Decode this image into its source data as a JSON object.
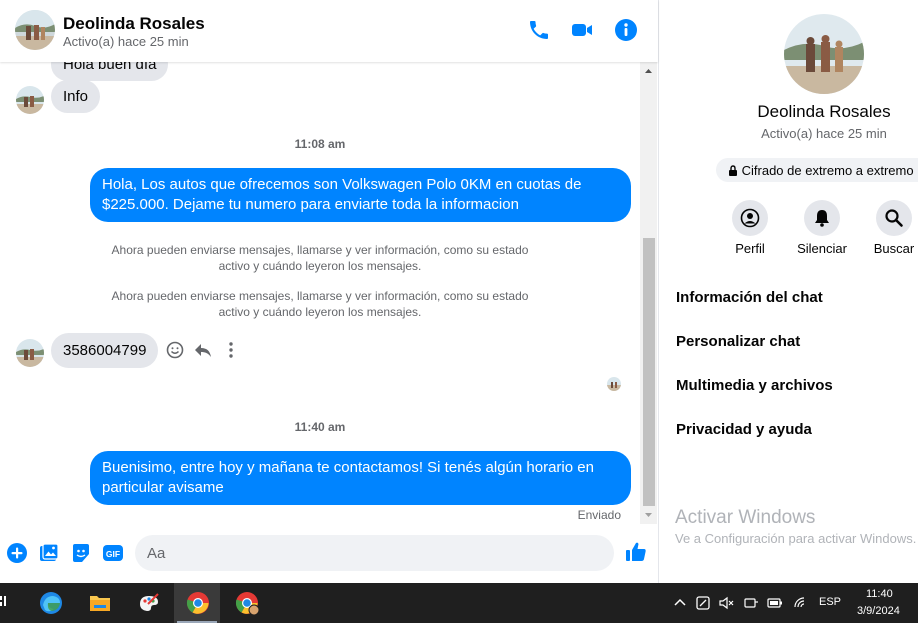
{
  "header": {
    "contact_name": "Deolinda Rosales",
    "status": "Activo(a) hace 25 min",
    "call_icon": "phone-icon",
    "video_icon": "video-icon",
    "info_icon": "info-icon"
  },
  "messages": {
    "partial_top": "Hola buen día",
    "incoming_info": "Info",
    "time_1": "11:08 am",
    "outgoing_1": "Hola, Los autos que ofrecemos son Volkswagen Polo 0KM en cuotas de $225.000. Dejame tu numero para enviarte toda la informacion",
    "system_1": "Ahora pueden enviarse mensajes, llamarse y ver información, como su estado activo y cuándo leyeron los mensajes.",
    "system_2": "Ahora pueden enviarse mensajes, llamarse y ver información, como su estado activo y cuándo leyeron los mensajes.",
    "incoming_phone": "3586004799",
    "time_2": "11:40 am",
    "outgoing_2": "Buenisimo, entre hoy y mañana te contactamos! Si tenés algún horario en particular avisame",
    "sent_status": "Enviado"
  },
  "composer": {
    "placeholder": "Aa",
    "icons": [
      "plus-icon",
      "photo-icon",
      "sticker-icon",
      "gif-icon",
      "emoji-icon",
      "like-icon"
    ]
  },
  "info_panel": {
    "name": "Deolinda Rosales",
    "status": "Activo(a) hace 25 min",
    "e2e_label": "Cifrado de extremo a extremo",
    "actions": [
      {
        "label": "Perfil",
        "icon": "profile-icon"
      },
      {
        "label": "Silenciar",
        "icon": "bell-icon"
      },
      {
        "label": "Buscar",
        "icon": "search-icon"
      }
    ],
    "menu": [
      "Información del chat",
      "Personalizar chat",
      "Multimedia y archivos",
      "Privacidad y ayuda"
    ],
    "watermark_title": "Activar Windows",
    "watermark_sub": "Ve a Configuración para activar Windows."
  },
  "taskbar": {
    "language": "ESP",
    "time": "11:40",
    "date": "3/9/2024"
  },
  "colors": {
    "accent": "#0084ff",
    "incoming_bubble": "#e4e6eb",
    "taskbar": "#1f1f1f"
  }
}
